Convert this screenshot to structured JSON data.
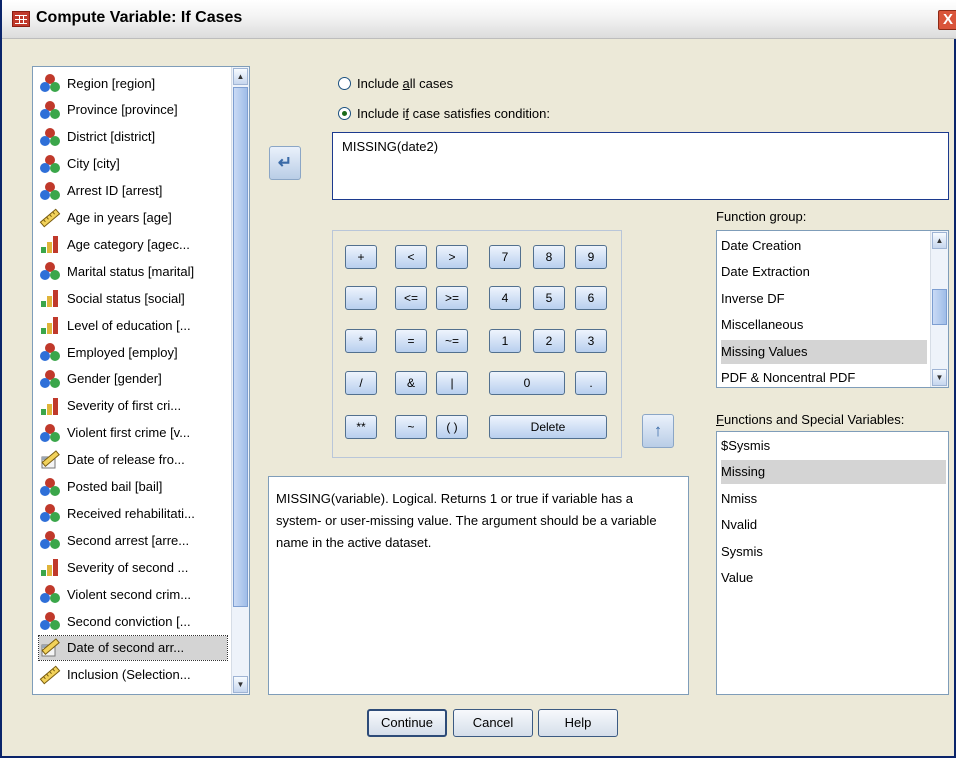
{
  "window": {
    "title": "Compute Variable: If Cases",
    "close_label": "X"
  },
  "variables": [
    {
      "label": "Region [region]",
      "icon": "nominal-icon"
    },
    {
      "label": "Province [province]",
      "icon": "nominal-icon"
    },
    {
      "label": "District [district]",
      "icon": "nominal-icon"
    },
    {
      "label": "City [city]",
      "icon": "nominal-icon"
    },
    {
      "label": "Arrest ID [arrest]",
      "icon": "nominal-icon"
    },
    {
      "label": "Age in years [age]",
      "icon": "scale-icon"
    },
    {
      "label": "Age category [agec...",
      "icon": "ordinal-icon"
    },
    {
      "label": "Marital status [marital]",
      "icon": "nominal-icon"
    },
    {
      "label": "Social status [social]",
      "icon": "ordinal-icon"
    },
    {
      "label": "Level of education [...",
      "icon": "ordinal-icon"
    },
    {
      "label": "Employed [employ]",
      "icon": "nominal-icon"
    },
    {
      "label": "Gender [gender]",
      "icon": "nominal-icon"
    },
    {
      "label": "Severity of first cri...",
      "icon": "ordinal-icon"
    },
    {
      "label": "Violent first crime [v...",
      "icon": "nominal-icon"
    },
    {
      "label": "Date of release fro...",
      "icon": "date-icon"
    },
    {
      "label": "Posted bail [bail]",
      "icon": "nominal-icon"
    },
    {
      "label": "Received rehabilitati...",
      "icon": "nominal-icon"
    },
    {
      "label": "Second arrest [arre...",
      "icon": "nominal-icon"
    },
    {
      "label": "Severity of second ...",
      "icon": "ordinal-icon"
    },
    {
      "label": "Violent second crim...",
      "icon": "nominal-icon"
    },
    {
      "label": "Second conviction [...",
      "icon": "nominal-icon"
    },
    {
      "label": "Date of second arr...",
      "icon": "date-icon",
      "selected": true
    },
    {
      "label": "Inclusion (Selection...",
      "icon": "scale-icon"
    }
  ],
  "radios": {
    "all_cases_prefix": "Include ",
    "all_cases_ul": "a",
    "all_cases_suffix": "ll cases",
    "condition_prefix": "Include i",
    "condition_ul": "f",
    "condition_suffix": " case satisfies condition:",
    "selected": "condition"
  },
  "expression": "MISSING(date2)",
  "keypad": {
    "plus": "+",
    "lt": "<",
    "gt": ">",
    "seven": "7",
    "eight": "8",
    "nine": "9",
    "minus": "-",
    "le": "<=",
    "ge": ">=",
    "four": "4",
    "five": "5",
    "six": "6",
    "times": "*",
    "eq": "=",
    "ne": "~=",
    "one": "1",
    "two": "2",
    "three": "3",
    "divide": "/",
    "and": "&",
    "or": "|",
    "zero": "0",
    "dot": ".",
    "power": "**",
    "not": "~",
    "parens": "( )",
    "delete": "Delete"
  },
  "function_group": {
    "label": "Function group:",
    "items": [
      "Date Creation",
      "Date Extraction",
      "Inverse DF",
      "Miscellaneous",
      "Missing Values",
      "PDF & Noncentral PDF"
    ],
    "selected": "Missing Values"
  },
  "functions": {
    "label_ul": "F",
    "label_rest": "unctions and Special Variables:",
    "items": [
      "$Sysmis",
      "Missing",
      "Nmiss",
      "Nvalid",
      "Sysmis",
      "Value"
    ],
    "selected": "Missing"
  },
  "description": "MISSING(variable). Logical. Returns 1 or true if variable has a system- or user-missing value. The argument should be a variable name in the active dataset.",
  "buttons": {
    "continue": "Continue",
    "cancel": "Cancel",
    "help": "Help"
  }
}
